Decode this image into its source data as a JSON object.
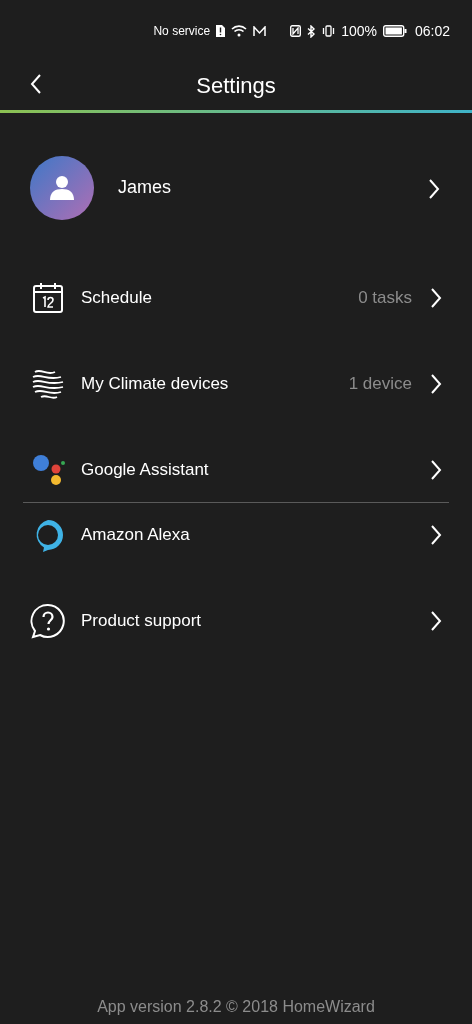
{
  "status_bar": {
    "carrier": "No service",
    "battery": "100%",
    "time": "06:02"
  },
  "header": {
    "title": "Settings"
  },
  "profile": {
    "name": "James"
  },
  "items": [
    {
      "kind": "schedule",
      "label": "Schedule",
      "value": "0 tasks",
      "divider": false
    },
    {
      "kind": "climate",
      "label": "My Climate devices",
      "value": "1 device",
      "divider": false
    },
    {
      "kind": "assistant",
      "label": "Google Assistant",
      "divider": true
    },
    {
      "kind": "alexa",
      "label": "Amazon Alexa",
      "divider": false
    },
    {
      "kind": "support",
      "label": "Product support",
      "divider": false
    }
  ],
  "footer": "App version 2.8.2 © 2018 HomeWizard"
}
